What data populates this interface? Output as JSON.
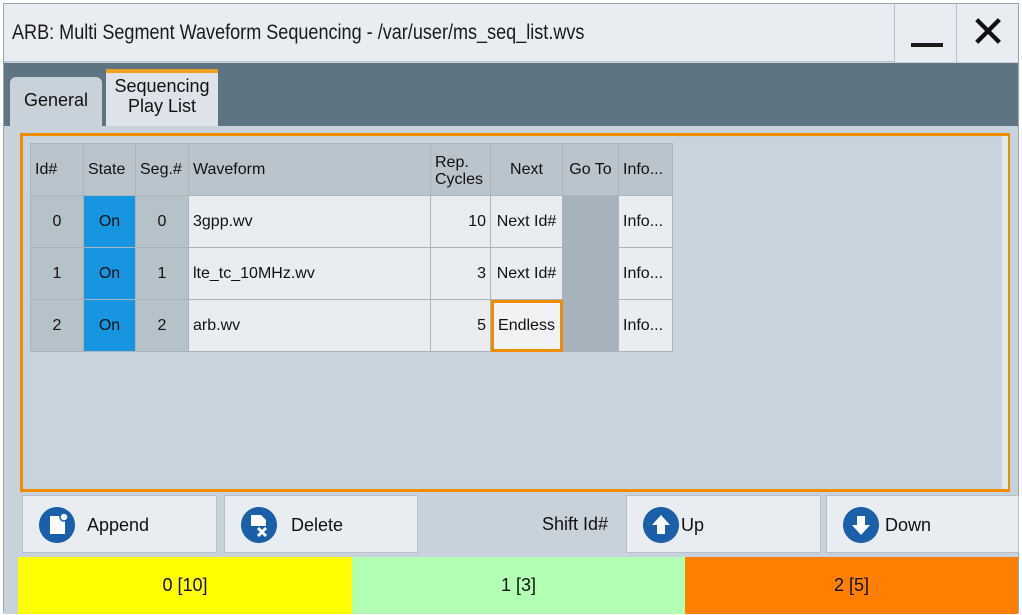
{
  "window": {
    "title": "ARB: Multi Segment Waveform Sequencing - /var/user/ms_seq_list.wvs",
    "minimize_icon": "minimize-icon",
    "close_icon": "close-icon",
    "close_glyph": "✕"
  },
  "tabs": [
    {
      "label": "General",
      "active": false
    },
    {
      "label_line1": "Sequencing",
      "label_line2": "Play List",
      "active": true
    }
  ],
  "table": {
    "headers": {
      "id": "Id#",
      "state": "State",
      "seg": "Seg.#",
      "waveform": "Waveform",
      "rep_line1": "Rep.",
      "rep_line2": "Cycles",
      "next": "Next",
      "goto": "Go To",
      "info": "Info..."
    },
    "rows": [
      {
        "id": "0",
        "state": "On",
        "seg": "0",
        "waveform": "3gpp.wv",
        "rep": "10",
        "next": "Next Id#",
        "goto": "",
        "info": "Info..."
      },
      {
        "id": "1",
        "state": "On",
        "seg": "1",
        "waveform": "lte_tc_10MHz.wv",
        "rep": "3",
        "next": "Next Id#",
        "goto": "",
        "info": "Info..."
      },
      {
        "id": "2",
        "state": "On",
        "seg": "2",
        "waveform": "arb.wv",
        "rep": "5",
        "next": "Endless",
        "goto": "",
        "info": "Info..."
      }
    ]
  },
  "buttons": {
    "append": "Append",
    "delete": "Delete",
    "shift_label": "Shift Id#",
    "up": "Up",
    "down": "Down"
  },
  "status_segments": [
    {
      "label": "0 [10]",
      "color": "#ffff00"
    },
    {
      "label": "1 [3]",
      "color": "#b3ffb3"
    },
    {
      "label": "2 [5]",
      "color": "#ff8000"
    }
  ],
  "colors": {
    "accent_orange": "#f08c00",
    "state_on_blue": "#1795e0",
    "icon_blue": "#1b5fa8"
  }
}
